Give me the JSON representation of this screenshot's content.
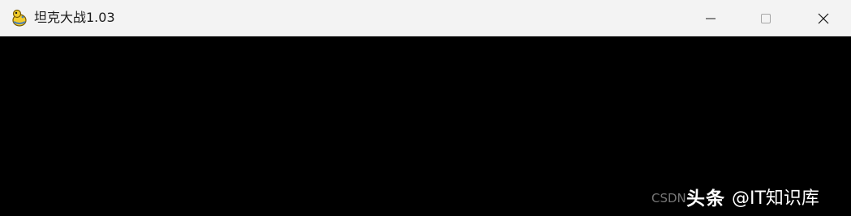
{
  "window": {
    "title": "坦克大战1.03",
    "icon": "pygame-snake-icon",
    "controls": [
      "minimize-icon",
      "maximize-icon",
      "close-icon"
    ]
  },
  "watermark": {
    "csdn": "CSDN",
    "toutiao_logo": "头条",
    "handle": "@IT知识库"
  }
}
